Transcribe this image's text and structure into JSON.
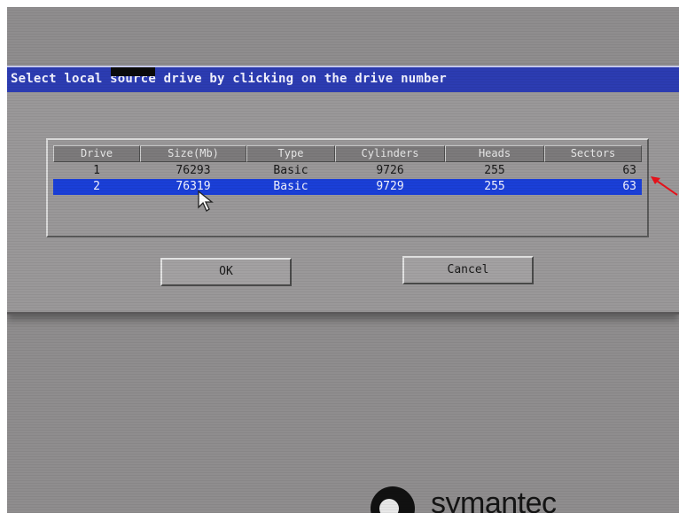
{
  "dialog": {
    "title": "Select local source drive by clicking on the drive number",
    "columns": [
      "Drive",
      "Size(Mb)",
      "Type",
      "Cylinders",
      "Heads",
      "Sectors"
    ],
    "rows": [
      {
        "drive": "1",
        "size": "76293",
        "type": "Basic",
        "cylinders": "9726",
        "heads": "255",
        "sectors": "63"
      },
      {
        "drive": "2",
        "size": "76319",
        "type": "Basic",
        "cylinders": "9729",
        "heads": "255",
        "sectors": "63"
      }
    ],
    "selected_row": 2,
    "ok_label": "OK",
    "cancel_label": "Cancel"
  },
  "branding": {
    "logo_text": "symantec"
  },
  "colors": {
    "title_bar": "#2c3cb2",
    "selection": "#1a3fd8",
    "background": "#8f8d8e",
    "annotation_arrow": "#e8121b"
  },
  "icons": [
    "mouse-cursor-icon",
    "red-arrow-annotation",
    "symantec-logo-icon"
  ]
}
